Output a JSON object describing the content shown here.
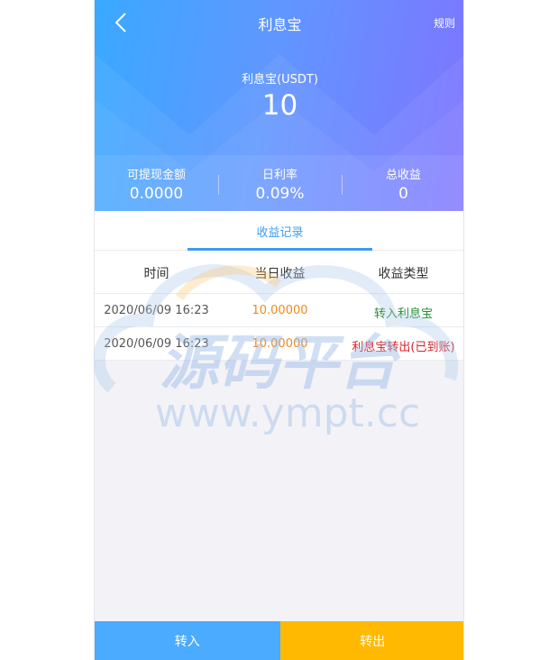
{
  "header": {
    "title": "利息宝",
    "rules_label": "规则",
    "balance_label": "利息宝(USDT)",
    "balance_value": "10"
  },
  "stats": [
    {
      "label": "可提现金额",
      "value": "0.0000"
    },
    {
      "label": "日利率",
      "value": "0.09%"
    },
    {
      "label": "总收益",
      "value": "0"
    }
  ],
  "tabs": {
    "active_label": "收益记录"
  },
  "table": {
    "columns": [
      "时间",
      "当日收益",
      "收益类型"
    ],
    "rows": [
      {
        "time": "2020/06/09 16:23",
        "amount": "10.00000",
        "type": "转入利息宝"
      },
      {
        "time": "2020/06/09 16:23",
        "amount": "10.00000",
        "type": "利息宝转出(已到账)"
      }
    ]
  },
  "watermark": {
    "brand_text": "源码平台",
    "url_text": "www.ympt.cc"
  },
  "buttons": {
    "in_label": "转入",
    "out_label": "转出"
  },
  "colors": {
    "accent_blue": "#3d9cf0",
    "in_button": "#4aabff",
    "out_button": "#ffb900",
    "amount": "#ef8a1c",
    "type_in": "#1f8f2f",
    "type_out": "#d4242a"
  },
  "icons": {
    "back": "chevron-left-icon"
  }
}
